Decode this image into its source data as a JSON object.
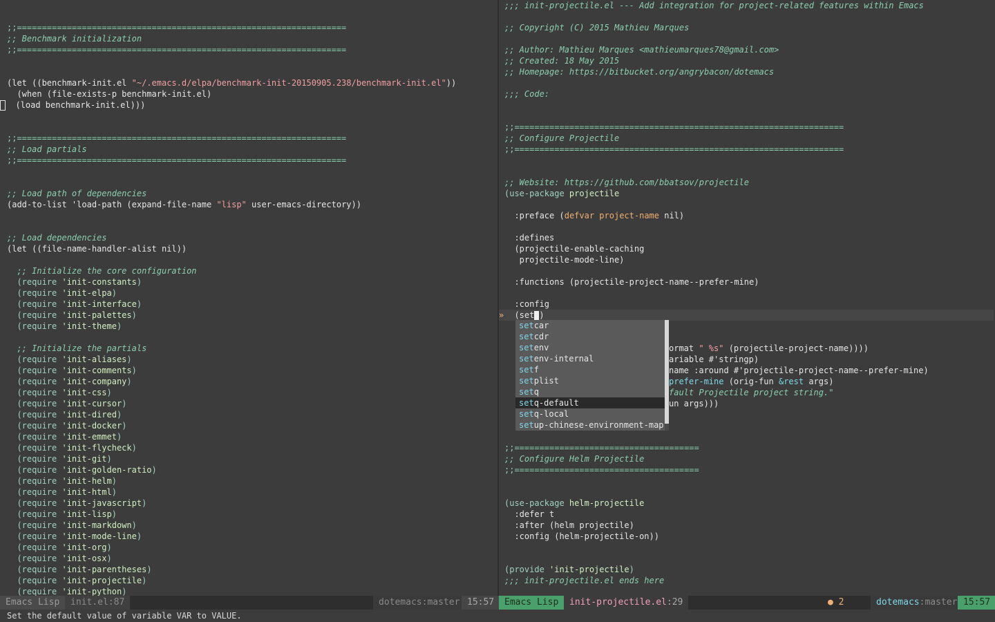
{
  "left_buffer": {
    "lines": [
      {
        "y": 0,
        "text": "",
        "cls": ""
      },
      {
        "y": 1,
        "text": "",
        "cls": ""
      },
      {
        "y": 2,
        "text": ";;==================================================================",
        "cls": "t-rule"
      },
      {
        "y": 3,
        "text": ";; Benchmark initialization",
        "cls": "t-comment"
      },
      {
        "y": 4,
        "text": ";;==================================================================",
        "cls": "t-rule"
      },
      {
        "y": 5,
        "text": "",
        "cls": ""
      },
      {
        "y": 6,
        "text": "",
        "cls": ""
      },
      {
        "y": 10,
        "text": "",
        "cls": ""
      },
      {
        "y": 11,
        "text": "",
        "cls": ""
      },
      {
        "y": 12,
        "text": ";;==================================================================",
        "cls": "t-rule"
      },
      {
        "y": 13,
        "text": ";; Load partials",
        "cls": "t-comment"
      },
      {
        "y": 14,
        "text": ";;==================================================================",
        "cls": "t-rule"
      },
      {
        "y": 15,
        "text": "",
        "cls": ""
      },
      {
        "y": 16,
        "text": "",
        "cls": ""
      },
      {
        "y": 17,
        "text": ";; Load path of dependencies",
        "cls": "t-comment"
      },
      {
        "y": 19,
        "text": "",
        "cls": ""
      },
      {
        "y": 20,
        "text": "",
        "cls": ""
      },
      {
        "y": 21,
        "text": ";; Load dependencies",
        "cls": "t-comment"
      },
      {
        "y": 23,
        "text": "",
        "cls": ""
      },
      {
        "y": 24,
        "text": "  ;; Initialize the core configuration",
        "cls": "t-comment"
      },
      {
        "y": 30,
        "text": "",
        "cls": ""
      },
      {
        "y": 31,
        "text": "  ;; Initialize the partials",
        "cls": "t-comment"
      }
    ],
    "let_line": {
      "open": "(let ((benchmark-init.el ",
      "str": "\"~/.emacs.d/elpa/benchmark-init-20150905.238/benchmark-init.el\"",
      "close": "))"
    },
    "when_line": "  (when (file-exists-p benchmark-init.el)",
    "load_line": "  (load benchmark-init.el)))",
    "add_to_list": {
      "pre": "(add-to-list 'load-path (expand-file-name ",
      "str": "\"lisp\"",
      "post": " user-emacs-directory))"
    },
    "let_handler": "(let ((file-name-handler-alist nil))",
    "core_requires": [
      "init-constants",
      "init-elpa",
      "init-interface",
      "init-palettes",
      "init-theme"
    ],
    "partial_requires": [
      "init-aliases",
      "init-comments",
      "init-company",
      "init-css",
      "init-cursor",
      "init-dired",
      "init-docker",
      "init-emmet",
      "init-flycheck",
      "init-git",
      "init-golden-ratio",
      "init-helm",
      "init-html",
      "init-javascript",
      "init-lisp",
      "init-markdown",
      "init-mode-line",
      "init-org",
      "init-osx",
      "init-parentheses",
      "init-projectile",
      "init-python"
    ]
  },
  "right_buffer": {
    "header1": ";;; init-projectile.el --- Add integration for project-related features within Emacs",
    "copyright": ";; Copyright (C) 2015 Mathieu Marques",
    "author": ";; Author: Mathieu Marques <mathieumarques78@gmail.com>",
    "created": ";; Created: 18 May 2015",
    "homepage": ";; Homepage: https://bitbucket.org/angrybacon/dotemacs",
    "code": ";;; Code:",
    "rule_long": ";;==================================================================",
    "rule_short": ";;=====================================",
    "configure_projectile": ";; Configure Projectile",
    "website": ";; Website: https://github.com/bbatsov/projectile",
    "use_package_1": {
      "open": "(use-package ",
      "name": "projectile"
    },
    "preface": {
      "kw": "  :preface ",
      "open": "(",
      "defvar": "defvar",
      "var": " project-name",
      "close": " nil)"
    },
    "defines": "  :defines",
    "defines_1": "  (projectile-enable-caching",
    "defines_2": "   projectile-mode-line)",
    "functions": "  :functions (projectile-project-name--prefer-mine)",
    "config": "  :config",
    "set_line": {
      "pre": "  (set",
      "post": ")"
    },
    "hidden_1": {
      "pre": "ormat ",
      "str": "\" %s\"",
      "post": " (projectile-project-name))))"
    },
    "hidden_2": "ariable #'stringp)",
    "hidden_3": "name :around #'projectile-project-name--prefer-mine)",
    "hidden_4": {
      "fn": "prefer-mine",
      "args": " (orig-fun ",
      "rest": "&rest",
      "post": " args)"
    },
    "hidden_5": "fault Projectile project string.\"",
    "hidden_6": "un args)))",
    "configure_helm": ";; Configure Helm Projectile",
    "use_package_2": {
      "open": "(use-package ",
      "name": "helm-projectile"
    },
    "defer": "  :defer t",
    "after": "  :after (helm projectile)",
    "config2": "  :config (helm-projectile-on))",
    "provide": {
      "open": "(provide ",
      "sym": "'init-projectile",
      "close": ")"
    },
    "footer": ";;; init-projectile.el ends here",
    "fringe_arrow": "»"
  },
  "completion": {
    "prefix": "set",
    "candidates": [
      "setcar",
      "setcdr",
      "setenv",
      "setenv-internal",
      "setf",
      "setplist",
      "setq",
      "setq-default",
      "setq-local",
      "setup-chinese-environment-map"
    ],
    "selected_index": 7
  },
  "modeline_left": {
    "mode": "Emacs Lisp",
    "file": "init.el:87",
    "branch": "dotemacs:master",
    "time": "15:57"
  },
  "modeline_right": {
    "mode": "Emacs Lisp",
    "file": "init-projectile.el",
    "line": ":29",
    "errors": "● 2",
    "branch_repo": "dotemacs",
    "branch_sep": ":",
    "branch_name": "master",
    "time": "15:57"
  },
  "echo_area": "Set the default value of variable VAR to VALUE.",
  "colors": {
    "background": "#3c3c3c",
    "comment": "#8ccfb0",
    "string": "#f0a0a0",
    "accent_green": "#4aa06a",
    "accent_cyan": "#80d8e8"
  }
}
